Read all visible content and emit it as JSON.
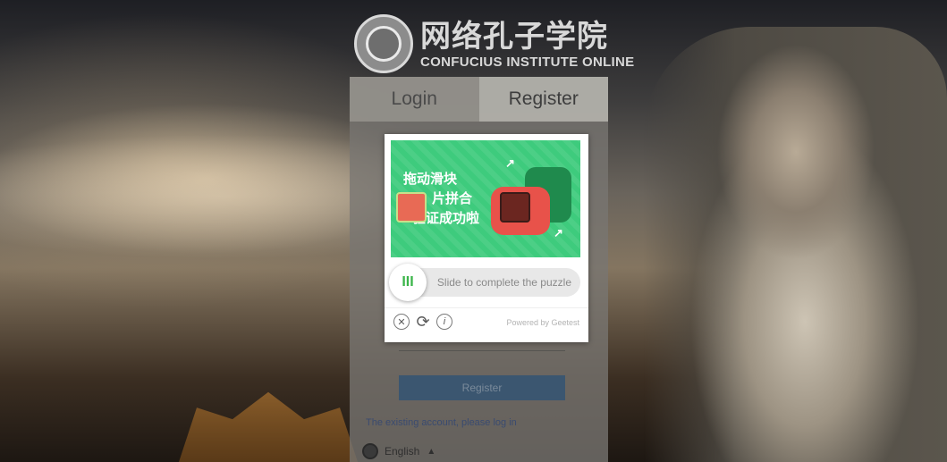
{
  "header": {
    "logo_cn": "网络孔子学院",
    "logo_en": "CONFUCIUS INSTITUTE ONLINE"
  },
  "tabs": {
    "login": "Login",
    "register": "Register"
  },
  "form": {
    "register_button": "Register",
    "existing_account_link": "The existing account, please log in",
    "language_label": "English"
  },
  "captcha": {
    "puzzle_lines": [
      "拖动滑块",
      "片拼合",
      "验证成功啦"
    ],
    "slider_prompt": "Slide to complete the puzzle",
    "powered_by": "Powered by Geetest",
    "icons": [
      "close-icon",
      "refresh-icon",
      "info-icon"
    ]
  },
  "colors": {
    "puzzle_bg": "#3ecb7d",
    "register_button_bg": "#3b5670",
    "link": "#3a4b70"
  }
}
